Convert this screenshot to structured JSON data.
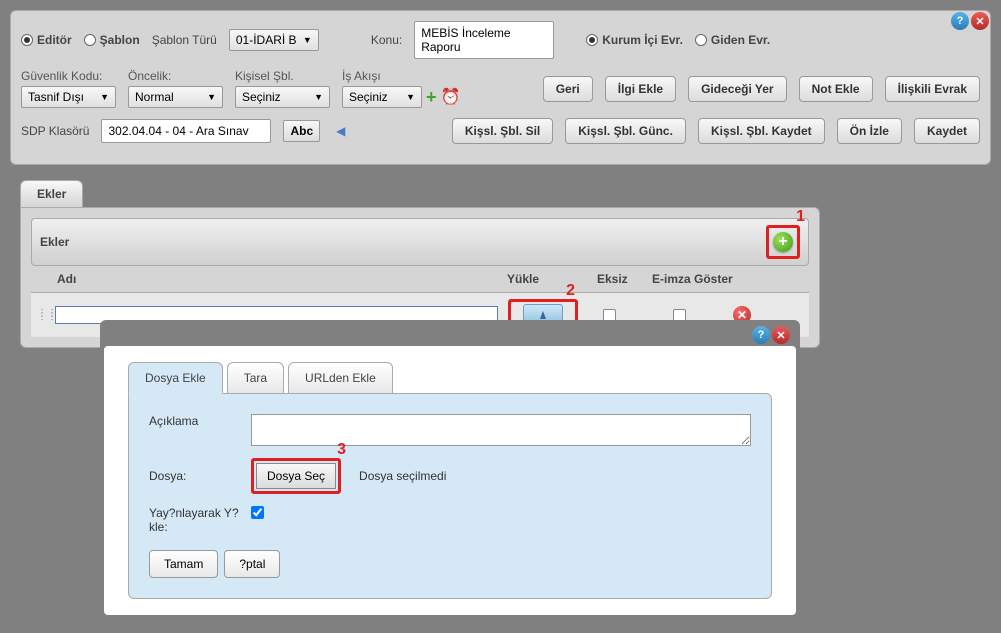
{
  "titlebar": {
    "help": "?",
    "close": "✕"
  },
  "row1": {
    "editor_label": "Editör",
    "sablon_label": "Şablon",
    "sablon_turu_label": "Şablon Türü",
    "sablon_turu_value": "01-İDARİ B",
    "konu_label": "Konu:",
    "konu_value": "MEBİS İnceleme Raporu",
    "kurum_ici_label": "Kurum İçi Evr.",
    "giden_evr_label": "Giden Evr."
  },
  "row2": {
    "guvenlik_label": "Güvenlik Kodu:",
    "guvenlik_value": "Tasnif Dışı",
    "oncelik_label": "Öncelik:",
    "oncelik_value": "Normal",
    "kisisel_label": "Kişisel Şbl.",
    "kisisel_value": "Seçiniz",
    "isakisi_label": "İş Akışı",
    "isakisi_value": "Seçiniz",
    "geri": "Geri",
    "ilgi_ekle": "İlgi Ekle",
    "gidecegi_yer": "Gideceği Yer",
    "not_ekle": "Not Ekle",
    "iliskili_evrak": "İlişkili Evrak"
  },
  "row3": {
    "sdp_label": "SDP Klasörü",
    "sdp_value": "302.04.04 - 04 - Ara Sınav",
    "abc_label": "Abc",
    "sil": "Kişsl. Şbl. Sil",
    "gunc": "Kişsl. Şbl. Günc.",
    "kaydet_sbl": "Kişsl. Şbl. Kaydet",
    "onizle": "Ön İzle",
    "kaydet": "Kaydet"
  },
  "ekler": {
    "tab_label": "Ekler",
    "header_label": "Ekler",
    "col_adi": "Adı",
    "col_yukle": "Yükle",
    "col_eksiz": "Eksiz",
    "col_eimza": "E-imza Göster"
  },
  "markers": {
    "m1": "1",
    "m2": "2",
    "m3": "3"
  },
  "dialog": {
    "tab_dosya": "Dosya Ekle",
    "tab_tara": "Tara",
    "tab_url": "URLden Ekle",
    "aciklama_label": "Açıklama",
    "dosya_label": "Dosya:",
    "dosya_sec": "Dosya Seç",
    "dosya_status": "Dosya seçilmedi",
    "yayin_label": "Yay?nlayarak Y?kle:",
    "tamam": "Tamam",
    "iptal": "?ptal"
  }
}
